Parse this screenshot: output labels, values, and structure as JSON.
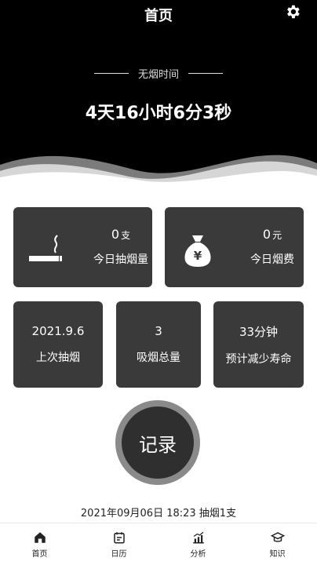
{
  "header": {
    "title": "首页",
    "settings_icon": "gear-icon",
    "section_label": "无烟时间",
    "elapsed": "4天16小时6分3秒"
  },
  "stats": {
    "today_count": {
      "value": "0",
      "unit": "支",
      "label": "今日抽烟量",
      "icon": "cigarette-icon"
    },
    "today_cost": {
      "value": "0",
      "unit": "元",
      "label": "今日烟费",
      "icon": "money-bag-icon"
    },
    "last_smoke": {
      "value": "2021.9.6",
      "label": "上次抽烟"
    },
    "total": {
      "value": "3",
      "label": "吸烟总量"
    },
    "life_reduced": {
      "value": "33分钟",
      "label": "预计减少寿命"
    }
  },
  "record_button": {
    "label": "记录"
  },
  "last_record": "2021年09月06日 18:23  抽烟1支",
  "tabs": [
    {
      "label": "首页",
      "icon": "home-icon"
    },
    {
      "label": "日历",
      "icon": "calendar-icon"
    },
    {
      "label": "分析",
      "icon": "chart-icon"
    },
    {
      "label": "知识",
      "icon": "graduation-cap-icon"
    }
  ],
  "colors": {
    "hero_bg": "#000000",
    "card_bg": "#3a3a3a",
    "text_light": "#ffffff"
  }
}
